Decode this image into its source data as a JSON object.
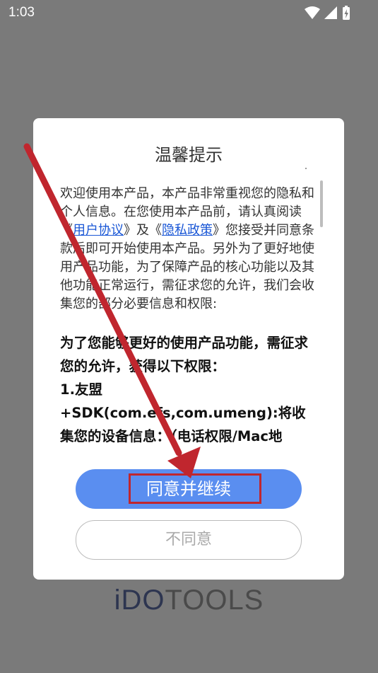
{
  "status_bar": {
    "time": "1:03",
    "icons": [
      "wifi-icon",
      "signal-icon",
      "battery-charging-icon"
    ]
  },
  "dialog": {
    "title": "温馨提示",
    "intro": {
      "part1": "欢迎使用本产品，本产品非常重视您的隐私和个人信息。在您使用本产品前，请认真阅读《",
      "user_agreement_link": "用户协议",
      "part2": "》及《",
      "privacy_policy_link": "隐私政策",
      "part3": "》您接受并同意条款后即可开始使用本产品。另外为了更好地使用产品功能，为了保障产品的核心功能以及其他功能正常运行，需征求您的允许，我们会收集您的部分必要信息和权限:"
    },
    "permissions_heading": "为了您能够更好的使用产品功能，需征求您的允许，获得以下权限：",
    "permission_item": "1.友盟+SDK(com.efs,com.umeng):将收集您的设备信息：（电话权限/Mac地址/MEI/android ID/IDFA/",
    "agree_button": "同意并继续",
    "decline_button": "不同意"
  },
  "brand": {
    "part1": "iDO",
    "part2": "TOOLS"
  },
  "colors": {
    "overlay": "#7a7a7a",
    "primary_button": "#5a8ef0",
    "link": "#1a57d6",
    "annotation_red": "#c0262e"
  }
}
